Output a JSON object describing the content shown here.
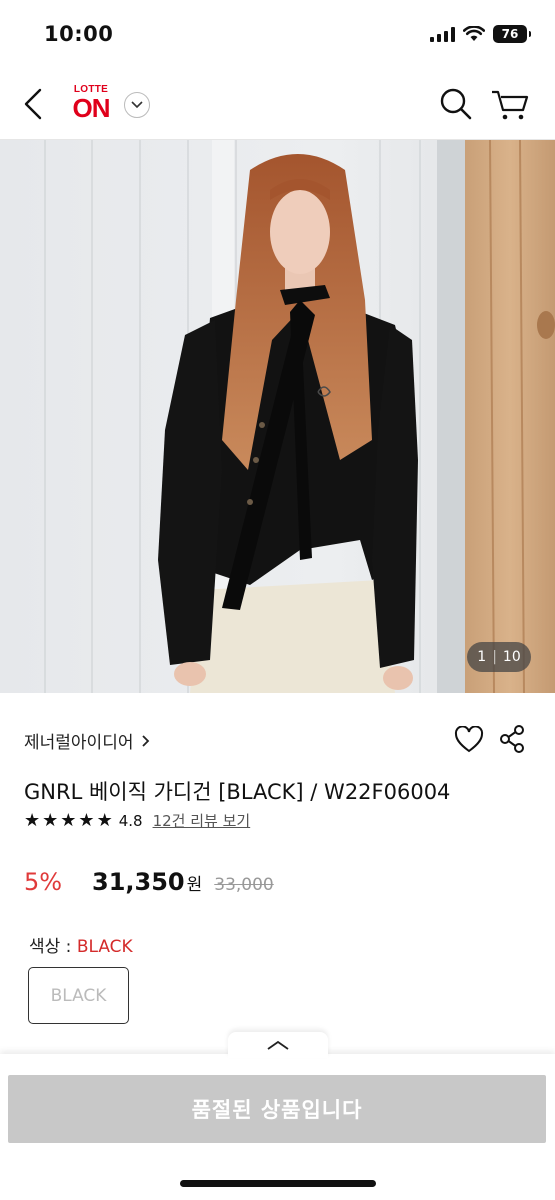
{
  "status_bar": {
    "time": "10:00",
    "battery": "76"
  },
  "header": {
    "logo_top": "LOTTE",
    "logo_main": "ON"
  },
  "gallery": {
    "current": "1",
    "total": "10"
  },
  "product": {
    "brand": "제너럴아이디어",
    "name": "GNRL 베이직 가디건 [BLACK] / W22F06004",
    "rating": "4.8",
    "stars": 5,
    "review_link": "12건 리뷰 보기",
    "discount": "5%",
    "price": "31,350",
    "currency": "원",
    "original_price": "33,000",
    "color_label": "색상 : ",
    "color_value": "BLACK",
    "options": [
      "BLACK"
    ]
  },
  "bottom": {
    "soldout_label": "품절된 상품입니다"
  },
  "colors": {
    "brand_red": "#e0001b",
    "discount_red": "#e03a3a",
    "disabled_gray": "#c8c8c8"
  }
}
